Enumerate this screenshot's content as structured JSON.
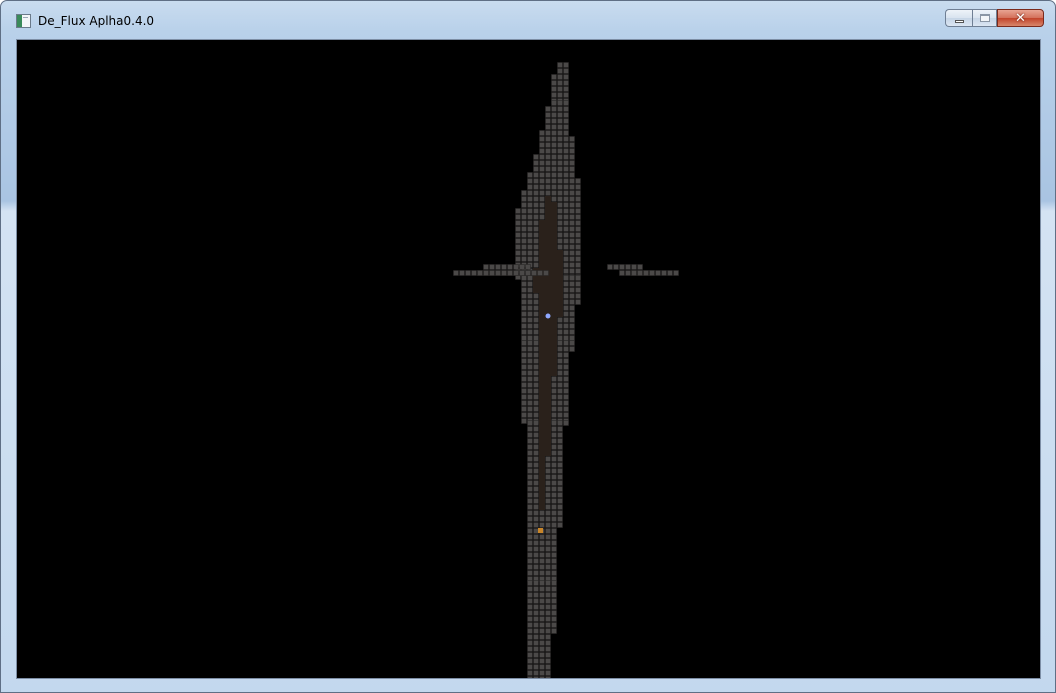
{
  "window": {
    "title": "De_Flux Aplha0.4.0",
    "close_glyph": "✕"
  },
  "icons": {
    "app": "app-window-icon",
    "minimize": "minimize-icon",
    "maximize": "maximize-icon",
    "close": "close-icon"
  },
  "colors": {
    "wall": "#4b4948",
    "wall_edge": "#2a2928",
    "floor": "#2a211b",
    "background": "#000000",
    "player": "#8fa8ff",
    "item": "#c8862a"
  }
}
